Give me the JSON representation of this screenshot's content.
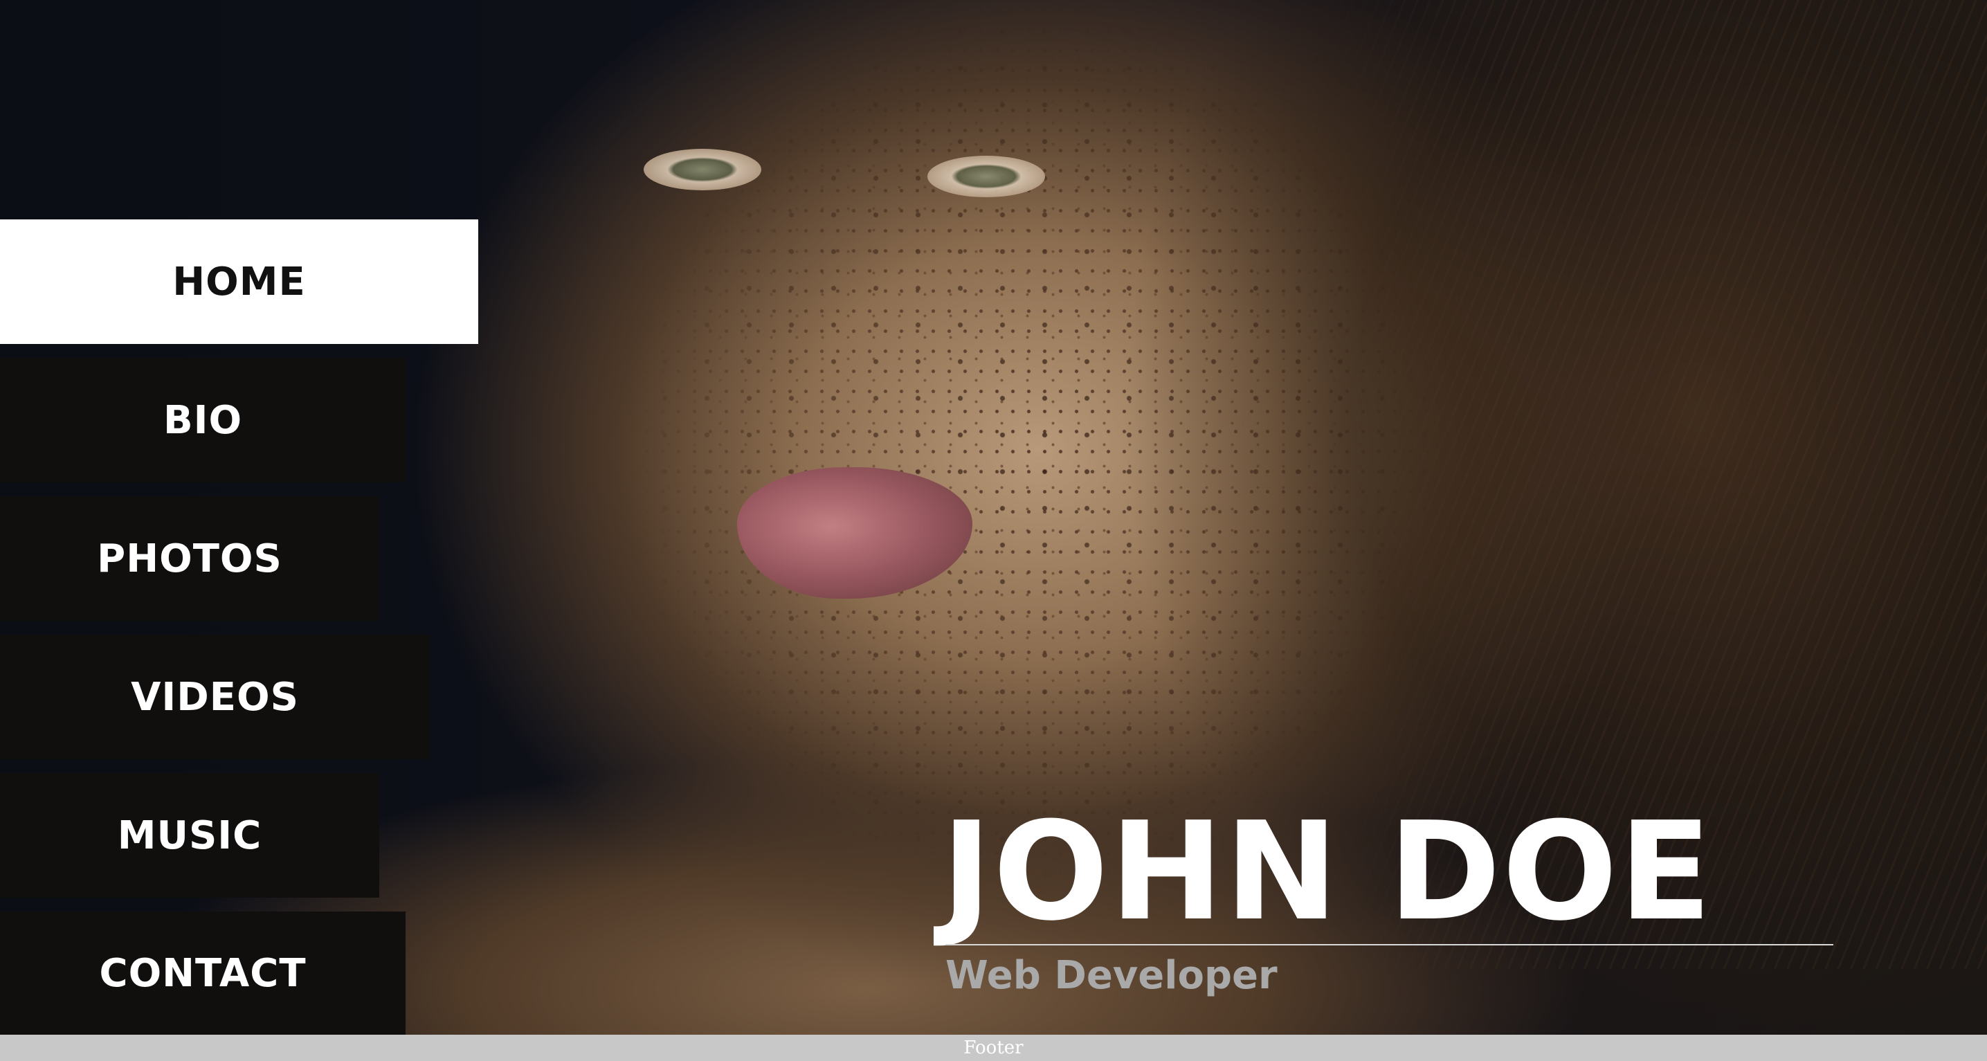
{
  "nav": {
    "items": [
      {
        "label": "HOME",
        "active": true
      },
      {
        "label": "BIO",
        "active": false
      },
      {
        "label": "PHOTOS",
        "active": false
      },
      {
        "label": "VIDEOS",
        "active": false
      },
      {
        "label": "MUSIC",
        "active": false
      },
      {
        "label": "CONTACT",
        "active": false
      }
    ]
  },
  "hero": {
    "name": "JOHN DOE",
    "role": "Web Developer"
  },
  "footer": {
    "text": "Footer"
  },
  "colors": {
    "background": "#0d0f16",
    "nav_bg": "#110e0e",
    "nav_active_bg": "#ffffff",
    "nav_active_text": "#111111",
    "title_text": "#ffffff",
    "subtitle_text": "#a9a9a9",
    "footer_bg": "#c8c8c8"
  }
}
